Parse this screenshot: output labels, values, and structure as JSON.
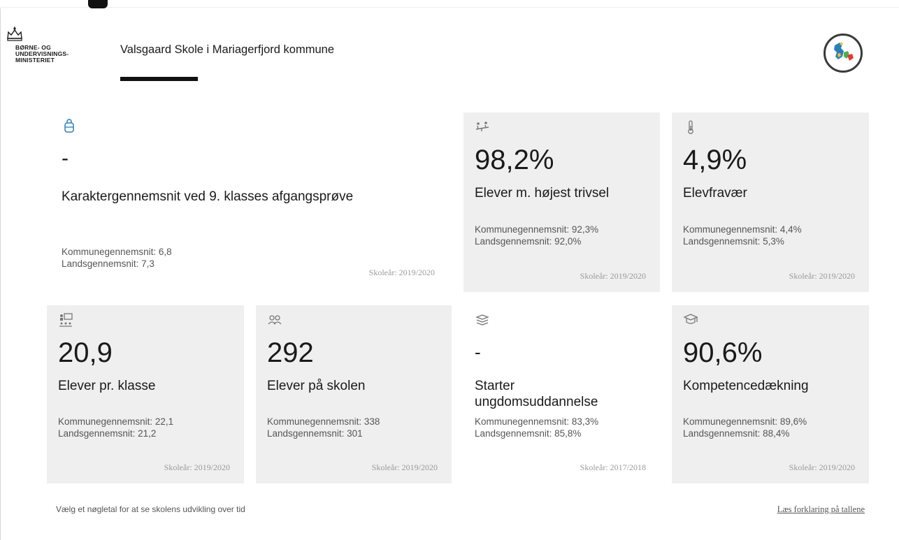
{
  "header": {
    "logo_lines": [
      "BØRNE- OG",
      "UNDERVISNINGS-",
      "MINISTERIET"
    ],
    "school_title": "Valsgaard Skole i Mariagerfjord kommune",
    "logo_icon": "crown-icon",
    "badge_icon": "denmark-map-icon"
  },
  "cards": {
    "grade_average": {
      "icon": "backpack-icon",
      "value": "-",
      "label": "Karaktergennemsnit ved 9. klasses afgangsprøve",
      "municipality": "Kommunegennemsnit: 6,8",
      "national": "Landsgennemsnit: 7,3",
      "year": "Skoleår: 2019/2020"
    },
    "wellbeing": {
      "icon": "students-swing-icon",
      "value": "98,2%",
      "label": "Elever m. højest trivsel",
      "municipality": "Kommunegennemsnit: 92,3%",
      "national": "Landsgennemsnit: 92,0%",
      "year": "Skoleår: 2019/2020"
    },
    "absence": {
      "icon": "thermometer-icon",
      "value": "4,9%",
      "label": "Elevfravær",
      "municipality": "Kommunegennemsnit: 4,4%",
      "national": "Landsgennemsnit: 5,3%",
      "year": "Skoleår: 2019/2020"
    },
    "class_size": {
      "icon": "classroom-icon",
      "value": "20,9",
      "label": "Elever pr. klasse",
      "municipality": "Kommunegennemsnit: 22,1",
      "national": "Landsgennemsnit: 21,2",
      "year": "Skoleår: 2019/2020"
    },
    "students": {
      "icon": "students-icon",
      "value": "292",
      "label": "Elever på skolen",
      "municipality": "Kommunegennemsnit: 338",
      "national": "Landsgennemsnit: 301",
      "year": "Skoleår: 2019/2020"
    },
    "youth_education": {
      "icon": "books-icon",
      "value": "-",
      "label": "Starter ungdomsuddannelse",
      "municipality": "Kommunegennemsnit: 83,3%",
      "national": "Landsgennemsnit: 85,8%",
      "year": "Skoleår: 2017/2018"
    },
    "competence": {
      "icon": "graduation-cap-icon",
      "value": "90,6%",
      "label": "Kompetencedækning",
      "municipality": "Kommunegennemsnit: 89,6%",
      "national": "Landsgennemsnit: 88,4%",
      "year": "Skoleår: 2019/2020"
    }
  },
  "footer": {
    "hint": "Vælg et nøgletal for at se skolens udvikling over tid",
    "link": "Læs forklaring på tallene"
  },
  "colors": {
    "card_background": "#efefef",
    "accent_blue": "#2a7fb8",
    "text_dark": "#1a1a1a",
    "text_muted": "#555555"
  }
}
